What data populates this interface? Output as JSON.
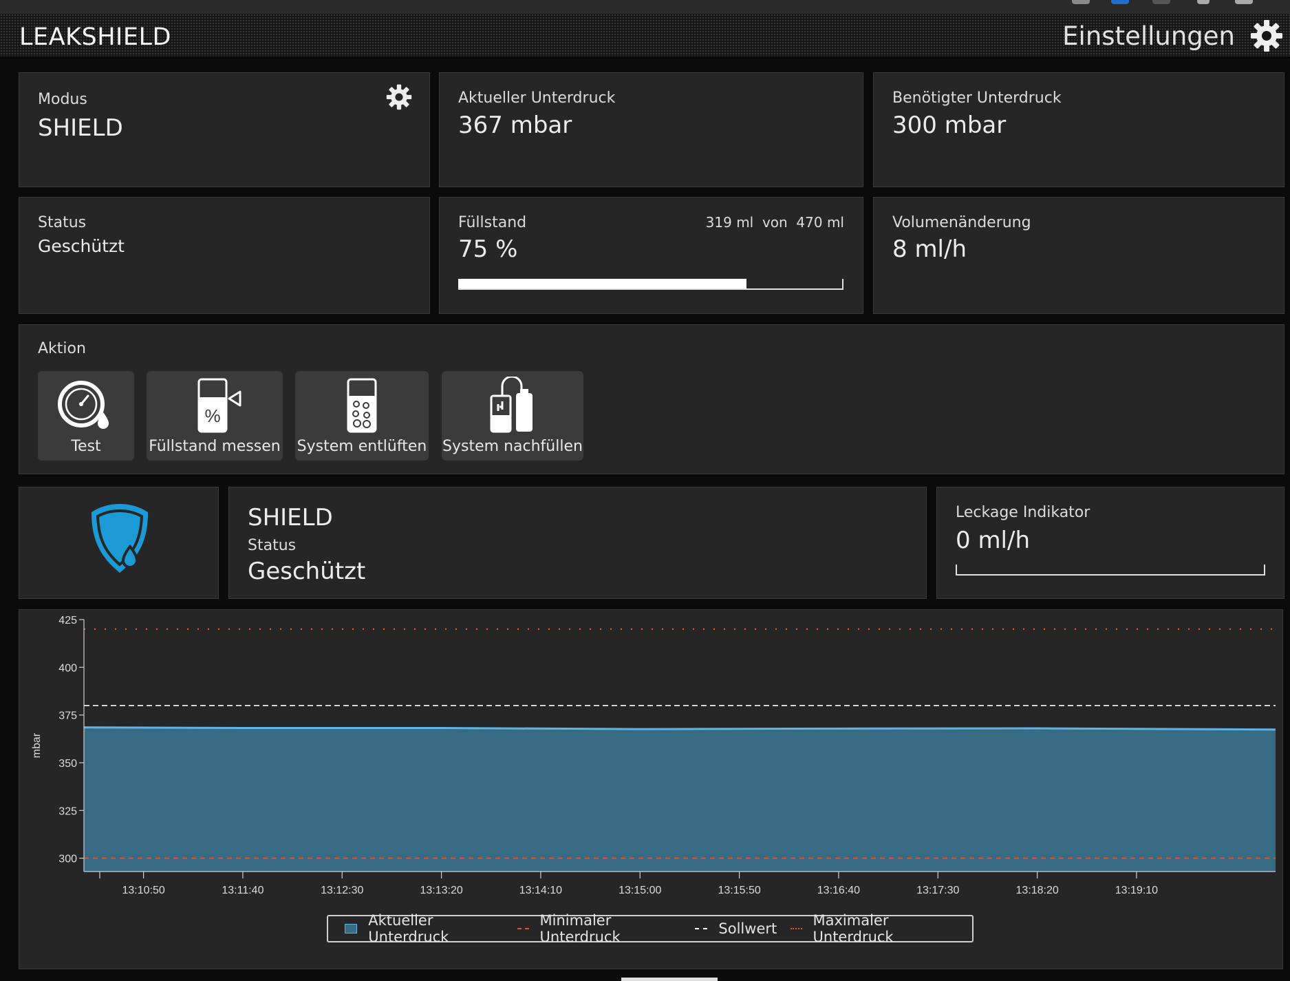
{
  "app": {
    "title": "LEAKSHIELD",
    "settings_label": "Einstellungen"
  },
  "cards": {
    "modus": {
      "label": "Modus",
      "value": "SHIELD"
    },
    "aktueller_unterdruck": {
      "label": "Aktueller Unterdruck",
      "value": "367 mbar"
    },
    "benoetigter_unterdruck": {
      "label": "Benötigter Unterdruck",
      "value": "300 mbar"
    },
    "status": {
      "label": "Status",
      "value": "Geschützt"
    },
    "fuellstand": {
      "label": "Füllstand",
      "value": "75 %",
      "detail": "319 ml  von  470 ml",
      "fraction": 0.75
    },
    "volumenaenderung": {
      "label": "Volumenänderung",
      "value": "8 ml/h"
    }
  },
  "aktion": {
    "label": "Aktion",
    "buttons": [
      {
        "label": "Test",
        "icon": "gauge-drop-icon"
      },
      {
        "label": "Füllstand messen",
        "icon": "fill-level-icon"
      },
      {
        "label": "System entlüften",
        "icon": "vent-system-icon"
      },
      {
        "label": "System nachfüllen",
        "icon": "refill-system-icon"
      }
    ]
  },
  "shield_panel": {
    "icon": "shield-drop-icon",
    "mode": "SHIELD",
    "status_label": "Status",
    "status_value": "Geschützt"
  },
  "leckage": {
    "label": "Leckage Indikator",
    "value": "0 ml/h",
    "fraction": 0
  },
  "colors": {
    "accent_blue": "#1c9ad6",
    "area_fill": "#366b83",
    "area_line": "#5fb3e6",
    "min_line": "#e0582a",
    "setpoint_line": "#ffffff",
    "max_line": "#e0582a"
  },
  "chart_data": {
    "type": "area",
    "ylabel": "mbar",
    "ylim": [
      293,
      425
    ],
    "yticks": [
      300,
      325,
      350,
      375,
      400,
      425
    ],
    "xlim": [
      "13:10:20",
      "13:20:20"
    ],
    "xticks": [
      "13:10:50",
      "13:11:40",
      "13:12:30",
      "13:13:20",
      "13:14:10",
      "13:15:00",
      "13:15:50",
      "13:16:40",
      "13:17:30",
      "13:18:20",
      "13:19:10"
    ],
    "grid": false,
    "legend_position": "bottom",
    "series": [
      {
        "name": "Aktueller Unterdruck",
        "style": "area",
        "x": [
          "13:10:20",
          "13:11:40",
          "13:13:20",
          "13:15:00",
          "13:16:40",
          "13:18:20",
          "13:20:20"
        ],
        "values": [
          368.5,
          368.2,
          368.2,
          367.6,
          367.9,
          368.0,
          367.4
        ]
      },
      {
        "name": "Minimaler Unterdruck",
        "style": "dashed",
        "values": [
          300
        ]
      },
      {
        "name": "Sollwert",
        "style": "dashed",
        "values": [
          380
        ]
      },
      {
        "name": "Maximaler Unterdruck",
        "style": "dotted",
        "values": [
          420
        ]
      }
    ]
  }
}
